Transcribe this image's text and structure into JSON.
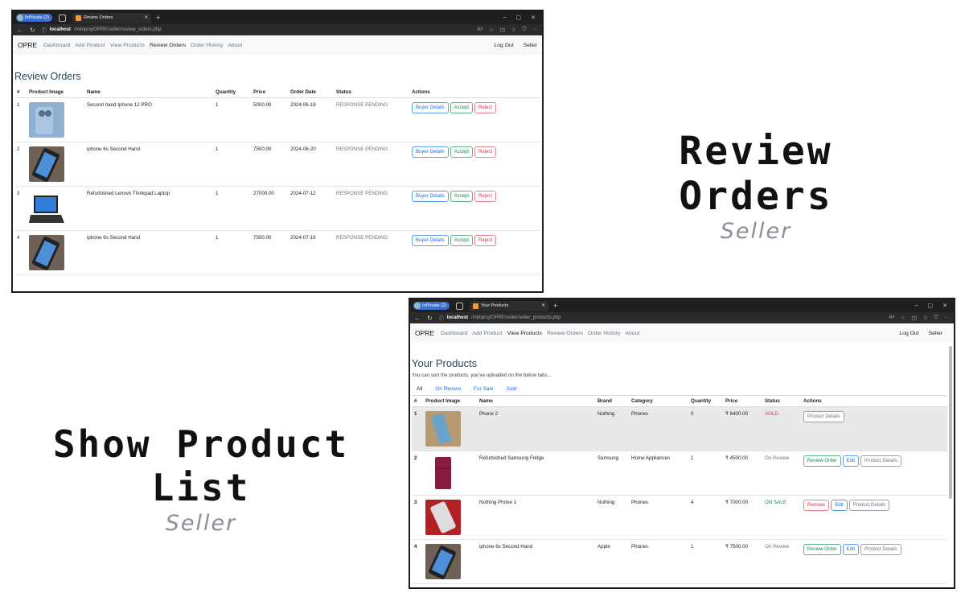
{
  "captions": {
    "review_orders": {
      "title": "Review Orders",
      "subtitle": "Seller"
    },
    "show_products": {
      "title": "Show Product List",
      "subtitle": "Seller"
    }
  },
  "windowA": {
    "profile_label": "InPrivate (2)",
    "tab_title": "Review Orders",
    "url_host": "localhost",
    "url_path": "/miniproj/OPRE/seller/review_orders.php",
    "nav": {
      "brand": "OPRE",
      "links": [
        "Dashboard",
        "Add Product",
        "View Products",
        "Review Orders",
        "Order History",
        "About"
      ],
      "logout": "Log Out",
      "role": "Seller"
    },
    "page_title": "Review Orders",
    "columns": [
      "#",
      "Product Image",
      "Name",
      "Quantity",
      "Price",
      "Order Date",
      "Status",
      "Actions"
    ],
    "actions": {
      "buyer": "Buyer Details",
      "accept": "Accept",
      "reject": "Reject"
    },
    "rows": [
      {
        "num": "1",
        "name": "Second hand Iphone 12 PRO",
        "quantity": "1",
        "price": "5000.00",
        "date": "2024-06-18",
        "status": "RESPONSE PENDING"
      },
      {
        "num": "2",
        "name": "iphone 6s Second Hand",
        "quantity": "1",
        "price": "7500.00",
        "date": "2024-06-20",
        "status": "RESPONSE PENDING"
      },
      {
        "num": "3",
        "name": "Refurbished Lenovo Thinkpad Laptop",
        "quantity": "1",
        "price": "27000.00",
        "date": "2024-07-12",
        "status": "RESPONSE PENDING"
      },
      {
        "num": "4",
        "name": "iphone 6s Second Hand",
        "quantity": "1",
        "price": "7500.00",
        "date": "2024-07-16",
        "status": "RESPONSE PENDING"
      }
    ]
  },
  "windowB": {
    "profile_label": "InPrivate (2)",
    "tab_title": "Your Products",
    "url_host": "localhost",
    "url_path": "/miniproj/OPRE/seller/seller_products.php",
    "nav": {
      "brand": "OPRE",
      "links": [
        "Dashboard",
        "Add Product",
        "View Products",
        "Review Orders",
        "Order History",
        "About"
      ],
      "logout": "Log Out",
      "role": "Seller"
    },
    "page_title": "Your Products",
    "subtitle": "You can sort the products, you've uploaded on the below tabs...",
    "filters": [
      "All",
      "On Review",
      "For Sale",
      "Sold"
    ],
    "columns": [
      "#",
      "Product Image",
      "Name",
      "Brand",
      "Category",
      "Quantity",
      "Price",
      "Status",
      "Actions"
    ],
    "actions": {
      "product_details": "Product Details",
      "review_order": "Review Order",
      "edit": "Edit",
      "remove": "Remove"
    },
    "rows": [
      {
        "num": "1",
        "name": "Phone 2",
        "brand": "Nothing",
        "category": "Phones",
        "quantity": "0",
        "price": "₹ 6400.00",
        "status": "SOLD"
      },
      {
        "num": "2",
        "name": "Refurbished Samsung Fridge",
        "brand": "Samsung",
        "category": "Home Appliances",
        "quantity": "1",
        "price": "₹ 4500.00",
        "status": "On Review"
      },
      {
        "num": "3",
        "name": "Nothing Phone 1",
        "brand": "Nothing",
        "category": "Phones",
        "quantity": "4",
        "price": "₹ 7000.00",
        "status": "ON SALE"
      },
      {
        "num": "4",
        "name": "iphone 6s Second Hand",
        "brand": "Apple",
        "category": "Phones",
        "quantity": "1",
        "price": "₹ 7500.00",
        "status": "On Review"
      }
    ]
  }
}
